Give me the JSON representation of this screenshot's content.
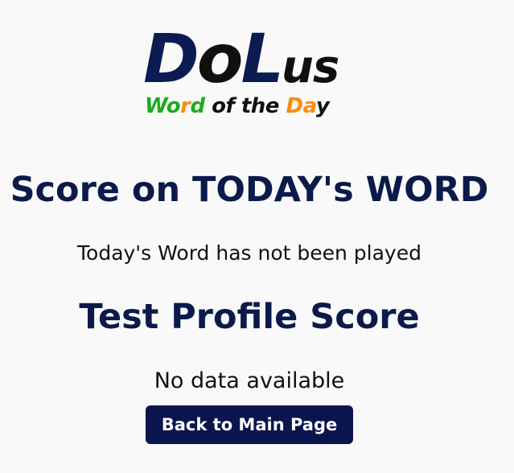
{
  "logo": {
    "letters": [
      "D",
      "o",
      "L",
      "us"
    ],
    "subtitle_parts": [
      "Wo",
      "r",
      "d",
      " of the ",
      "Da",
      "y"
    ]
  },
  "score_section": {
    "title": "Score on TODAY's WORD",
    "status": "Today's Word has not been played"
  },
  "profile_section": {
    "title": "Test Profile Score",
    "status": "No data available"
  },
  "actions": {
    "back_label": "Back to Main Page"
  }
}
